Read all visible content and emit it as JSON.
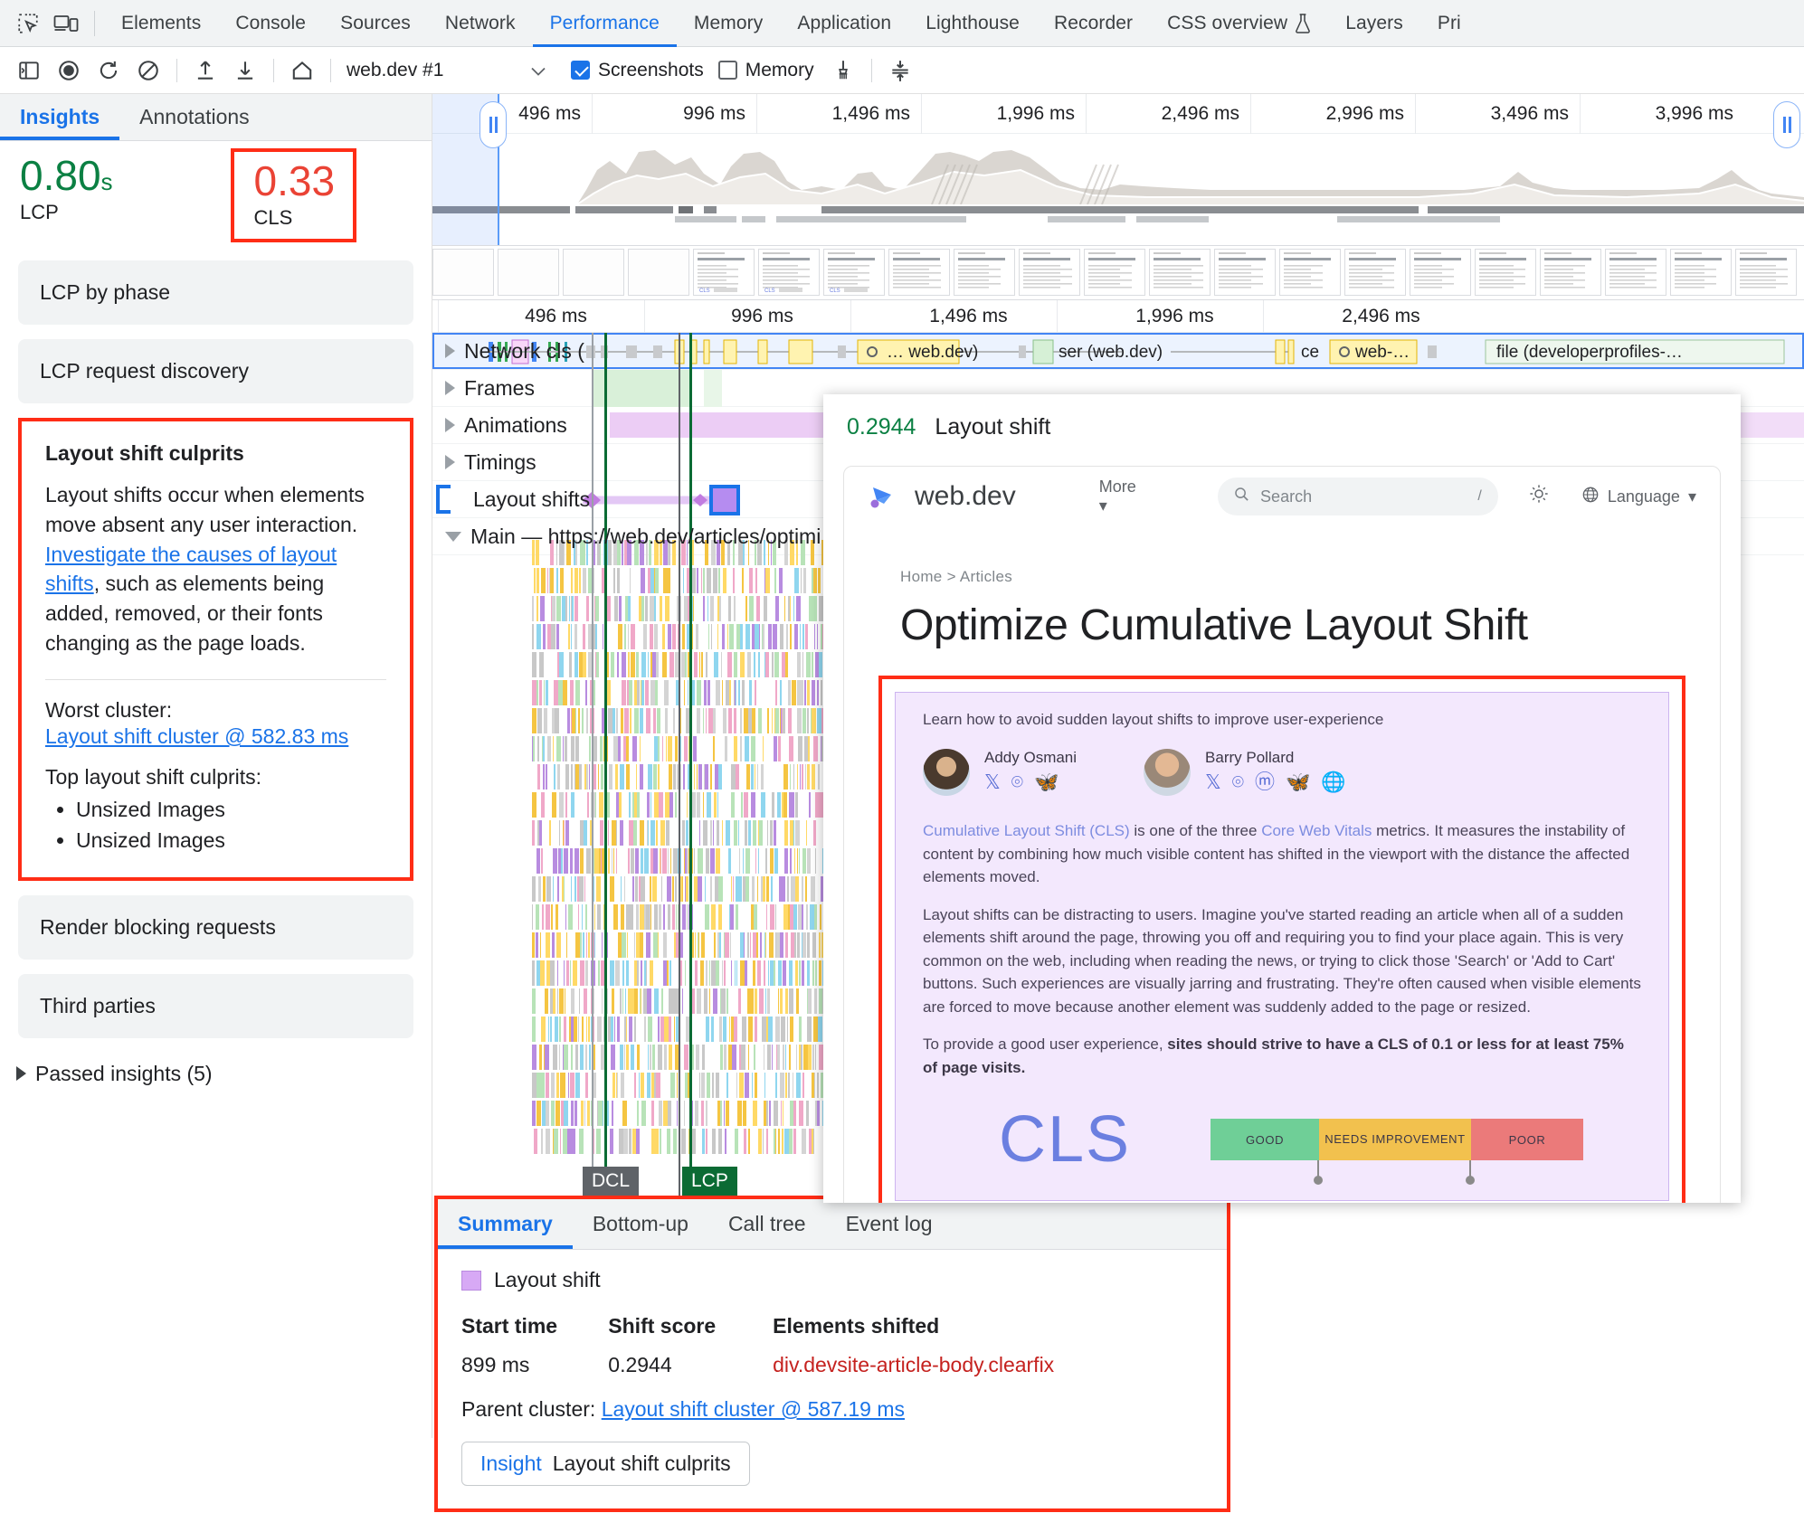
{
  "devtools": {
    "tabs": [
      {
        "label": "Elements",
        "active": false
      },
      {
        "label": "Console",
        "active": false
      },
      {
        "label": "Sources",
        "active": false
      },
      {
        "label": "Network",
        "active": false
      },
      {
        "label": "Performance",
        "active": true
      },
      {
        "label": "Memory",
        "active": false
      },
      {
        "label": "Application",
        "active": false
      },
      {
        "label": "Lighthouse",
        "active": false
      },
      {
        "label": "Recorder",
        "active": false
      },
      {
        "label": "CSS overview",
        "active": false,
        "flask": true
      },
      {
        "label": "Layers",
        "active": false
      },
      {
        "label": "Pri",
        "active": false
      }
    ],
    "icons": {
      "inspect": "inspect-element-icon",
      "device": "device-toolbar-icon"
    }
  },
  "toolbar": {
    "icons": [
      "sidebar-toggle-icon",
      "record-icon",
      "reload-record-icon",
      "clear-icon",
      "upload-icon",
      "download-icon",
      "home-icon",
      "garbage-collect-icon",
      "collapse-icon"
    ],
    "session": "web.dev #1",
    "screenshots_label": "Screenshots",
    "screenshots_checked": true,
    "memory_label": "Memory",
    "memory_checked": false
  },
  "sidebar": {
    "tabs": [
      {
        "label": "Insights",
        "active": true
      },
      {
        "label": "Annotations",
        "active": false
      }
    ],
    "metrics": [
      {
        "value": "0.80",
        "unit": "s",
        "label": "LCP",
        "status": "good",
        "highlighted": false
      },
      {
        "value": "0.33",
        "unit": "",
        "label": "CLS",
        "status": "bad",
        "highlighted": true
      }
    ],
    "cards_before": [
      {
        "label": "LCP by phase"
      },
      {
        "label": "LCP request discovery"
      }
    ],
    "open_card": {
      "title": "Layout shift culprits",
      "description_before_link": "Layout shifts occur when elements move absent any user interaction. ",
      "link_text": "Investigate the causes of layout shifts",
      "description_after_link": ", such as elements being added, removed, or their fonts changing as the page loads.",
      "worst_cluster_label": "Worst cluster:",
      "worst_cluster_link": "Layout shift cluster @ 582.83 ms",
      "top_culprits_label": "Top layout shift culprits:",
      "culprits": [
        "Unsized Images",
        "Unsized Images"
      ]
    },
    "cards_after": [
      {
        "label": "Render blocking requests"
      },
      {
        "label": "Third parties"
      }
    ],
    "passed_insights": "Passed insights (5)"
  },
  "overview": {
    "ticks": [
      "496 ms",
      "996 ms",
      "1,496 ms",
      "1,996 ms",
      "2,496 ms",
      "2,996 ms",
      "3,496 ms",
      "3,996 ms"
    ]
  },
  "flame": {
    "ticks": [
      "496 ms",
      "996 ms",
      "1,496 ms",
      "1,996 ms",
      "2,496 ms"
    ],
    "tracks": [
      {
        "name": "Network cls (",
        "selected": true,
        "expander": "collapsed"
      },
      {
        "name": "Frames",
        "selected": false,
        "expander": "collapsed"
      },
      {
        "name": "Animations",
        "selected": false,
        "expander": "collapsed"
      },
      {
        "name": "Timings",
        "selected": false,
        "expander": "collapsed"
      },
      {
        "name": "Layout shifts",
        "selected": false,
        "bracket": true,
        "expander": "none"
      },
      {
        "name": "Main — https://web.dev/articles/optimi",
        "selected": false,
        "expander": "expanded"
      }
    ],
    "event_labels": [
      "… web.dev)",
      "ser (web.dev)",
      "ce",
      "web-…",
      "file (developerprofiles-…"
    ],
    "markers": [
      {
        "label": "DCL",
        "kind": "dcl"
      },
      {
        "label": "LCP",
        "kind": "lcp"
      }
    ]
  },
  "popup": {
    "score": "0.2944",
    "title": "Layout shift",
    "preview": {
      "brand": "web.dev",
      "nav_more": "More",
      "search_placeholder": "Search",
      "search_shortcut": "/",
      "language": "Language",
      "breadcrumb": "Home  >  Articles",
      "page_title": "Optimize Cumulative Layout Shift",
      "lead": "Learn how to avoid sudden layout shifts to improve user-experience",
      "authors": [
        {
          "name": "Addy Osmani",
          "socials": [
            "X",
            "github-icon",
            "bluesky-icon"
          ]
        },
        {
          "name": "Barry Pollard",
          "socials": [
            "X",
            "github-icon",
            "mastodon-icon",
            "bluesky-icon",
            "globe-icon"
          ]
        }
      ],
      "paragraphs": [
        {
          "parts": [
            {
              "t": "Cumulative Layout Shift (CLS)",
              "style": "link"
            },
            {
              "t": " is one of the three ",
              "style": "normal"
            },
            {
              "t": "Core Web Vitals",
              "style": "link"
            },
            {
              "t": " metrics. It measures the instability of content by combining how much visible content has shifted in the viewport with the distance the affected elements moved.",
              "style": "normal"
            }
          ]
        },
        {
          "parts": [
            {
              "t": "Layout shifts can be distracting to users. Imagine you've started reading an article when all of a sudden elements shift around the page, throwing you off and requiring you to find your place again. This is very common on the web, including when reading the news, or trying to click those 'Search' or 'Add to Cart' buttons. Such experiences are visually jarring and frustrating. They're often caused when visible elements are forced to move because another element was suddenly added to the page or resized.",
              "style": "normal"
            }
          ]
        },
        {
          "parts": [
            {
              "t": "To provide a good user experience, ",
              "style": "normal"
            },
            {
              "t": "sites should strive to have a CLS of 0.1 or less for at least 75% of page visits.",
              "style": "bold"
            }
          ]
        }
      ],
      "cls_big": "CLS",
      "cls_scale": [
        {
          "label": "GOOD",
          "color": "#6fcf97"
        },
        {
          "label": "NEEDS IMPROVEMENT",
          "color": "#f2c14e"
        },
        {
          "label": "POOR",
          "color": "#eb7a7a"
        }
      ]
    }
  },
  "bottom": {
    "tabs": [
      {
        "label": "Summary",
        "active": true
      },
      {
        "label": "Bottom-up",
        "active": false
      },
      {
        "label": "Call tree",
        "active": false
      },
      {
        "label": "Event log",
        "active": false
      }
    ],
    "legend": "Layout shift",
    "columns": [
      "Start time",
      "Shift score",
      "Elements shifted"
    ],
    "rows": [
      {
        "start_time": "899 ms",
        "shift_score": "0.2944",
        "element": "div.devsite-article-body.clearfix"
      }
    ],
    "parent_cluster_label": "Parent cluster:",
    "parent_cluster_link": "Layout shift cluster @ 587.19 ms",
    "insight_prefix": "Insight",
    "insight_label": "Layout shift culprits"
  },
  "colors": {
    "accent": "#1a73e8",
    "good": "#0b8043",
    "bad": "#ea4335",
    "highlight_box": "#ff2d16",
    "layout_shift": "#d7a9f5"
  }
}
